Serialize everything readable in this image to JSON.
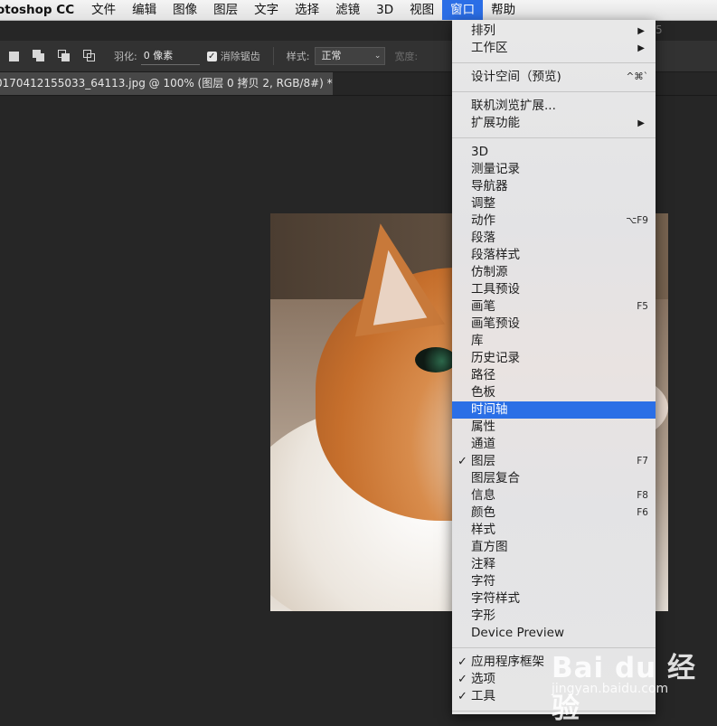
{
  "menubar": {
    "app_name": "otoshop CC",
    "items": [
      "文件",
      "编辑",
      "图像",
      "图层",
      "文字",
      "选择",
      "滤镜",
      "3D",
      "视图",
      "窗口",
      "帮助"
    ],
    "active_item": "窗口"
  },
  "options_bar": {
    "feather_label": "羽化:",
    "feather_value": "0 像素",
    "antialias_label": "消除锯齿",
    "antialias_checked": true,
    "style_label": "样式:",
    "style_value": "正常",
    "width_label": "宽度:"
  },
  "document_tab": {
    "title": "0170412155033_64113.jpg @ 100% (图层 0 拷贝 2, RGB/8#) *"
  },
  "ghost_text": "5",
  "window_menu": {
    "items": [
      {
        "label": "排列",
        "submenu": true
      },
      {
        "label": "工作区",
        "submenu": true
      },
      {
        "divider": true
      },
      {
        "label": "设计空间（预览)",
        "shortcut": "^⌘`"
      },
      {
        "divider": true
      },
      {
        "label": "联机浏览扩展..."
      },
      {
        "label": "扩展功能",
        "submenu": true
      },
      {
        "divider": true
      },
      {
        "label": "3D"
      },
      {
        "label": "测量记录"
      },
      {
        "label": "导航器"
      },
      {
        "label": "调整"
      },
      {
        "label": "动作",
        "shortcut": "⌥F9"
      },
      {
        "label": "段落"
      },
      {
        "label": "段落样式"
      },
      {
        "label": "仿制源"
      },
      {
        "label": "工具预设"
      },
      {
        "label": "画笔",
        "shortcut": "F5"
      },
      {
        "label": "画笔预设"
      },
      {
        "label": "库"
      },
      {
        "label": "历史记录"
      },
      {
        "label": "路径"
      },
      {
        "label": "色板"
      },
      {
        "label": "时间轴",
        "highlighted": true
      },
      {
        "label": "属性"
      },
      {
        "label": "通道"
      },
      {
        "label": "图层",
        "checked": true,
        "shortcut": "F7"
      },
      {
        "label": "图层复合"
      },
      {
        "label": "信息",
        "shortcut": "F8"
      },
      {
        "label": "颜色",
        "shortcut": "F6"
      },
      {
        "label": "样式"
      },
      {
        "label": "直方图"
      },
      {
        "label": "注释"
      },
      {
        "label": "字符"
      },
      {
        "label": "字符样式"
      },
      {
        "label": "字形"
      },
      {
        "label": "Device Preview"
      },
      {
        "divider": true
      },
      {
        "label": "应用程序框架",
        "checked": true
      },
      {
        "label": "选项",
        "checked": true
      },
      {
        "label": "工具",
        "checked": true
      },
      {
        "divider": true
      }
    ]
  },
  "watermark": {
    "brand": "Bai du 经验",
    "url": "jingyan.baidu.com"
  },
  "colors": {
    "menu_highlight": "#2b6fe6",
    "canvas_bg": "#262626",
    "options_bar_bg": "#323232"
  }
}
